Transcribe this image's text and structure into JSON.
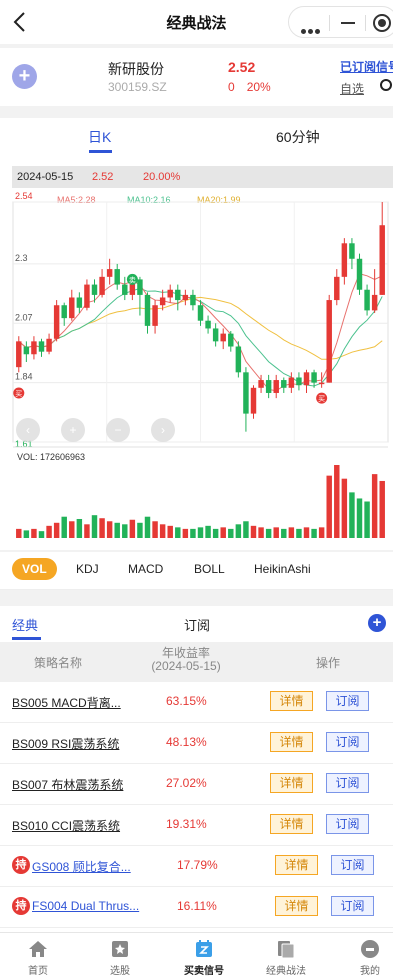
{
  "header": {
    "title": "经典战法"
  },
  "stock": {
    "name": "新研股份",
    "code": "300159.SZ",
    "price": "2.52",
    "change": "0",
    "change_pct": "20%",
    "subscribed_label": "已订阅信号",
    "watchlist_label": "自选"
  },
  "period_tabs": [
    "日K",
    "60分钟"
  ],
  "chart_info": {
    "date": "2024-05-15",
    "price": "2.52",
    "pct": "20.00%"
  },
  "ma": {
    "ma5": "MA5:2.28",
    "ma10": "MA10:2.16",
    "ma20": "MA20:1.99"
  },
  "colors": {
    "up": "#e53935",
    "down": "#21b259",
    "ma5": "#e8716d",
    "ma10": "#4cc28f",
    "ma20": "#f0c040",
    "accent": "#2f54d6"
  },
  "chart_data": {
    "type": "candlestick",
    "y_ticks": [
      "2.54",
      "2.3",
      "2.07",
      "1.84",
      "1.61"
    ],
    "ylim": [
      1.61,
      2.54
    ],
    "candles": [
      [
        1.9,
        2.0,
        2.02,
        1.88
      ],
      [
        1.98,
        1.95,
        2.0,
        1.92
      ],
      [
        1.95,
        2.0,
        2.02,
        1.93
      ],
      [
        2.0,
        1.96,
        2.01,
        1.94
      ],
      [
        1.96,
        2.01,
        2.03,
        1.95
      ],
      [
        2.01,
        2.14,
        2.16,
        2.0
      ],
      [
        2.14,
        2.09,
        2.15,
        2.06
      ],
      [
        2.09,
        2.17,
        2.2,
        2.08
      ],
      [
        2.17,
        2.13,
        2.19,
        2.11
      ],
      [
        2.13,
        2.22,
        2.24,
        2.12
      ],
      [
        2.22,
        2.18,
        2.24,
        2.15
      ],
      [
        2.18,
        2.25,
        2.28,
        2.17
      ],
      [
        2.25,
        2.28,
        2.32,
        2.22
      ],
      [
        2.28,
        2.22,
        2.3,
        2.2
      ],
      [
        2.22,
        2.18,
        2.25,
        2.16
      ],
      [
        2.18,
        2.24,
        2.26,
        2.16
      ],
      [
        2.24,
        2.18,
        2.25,
        2.1
      ],
      [
        2.18,
        2.06,
        2.19,
        2.03
      ],
      [
        2.06,
        2.14,
        2.16,
        2.03
      ],
      [
        2.14,
        2.17,
        2.2,
        2.12
      ],
      [
        2.17,
        2.2,
        2.22,
        2.15
      ],
      [
        2.2,
        2.16,
        2.22,
        2.12
      ],
      [
        2.16,
        2.18,
        2.2,
        2.14
      ],
      [
        2.18,
        2.14,
        2.2,
        2.12
      ],
      [
        2.14,
        2.08,
        2.16,
        2.06
      ],
      [
        2.08,
        2.05,
        2.1,
        2.03
      ],
      [
        2.05,
        2.0,
        2.07,
        1.98
      ],
      [
        2.0,
        2.03,
        2.05,
        1.97
      ],
      [
        2.03,
        1.98,
        2.04,
        1.96
      ],
      [
        1.98,
        1.88,
        2.0,
        1.86
      ],
      [
        1.88,
        1.72,
        1.9,
        1.65
      ],
      [
        1.72,
        1.82,
        1.83,
        1.7
      ],
      [
        1.82,
        1.85,
        1.87,
        1.8
      ],
      [
        1.85,
        1.8,
        1.87,
        1.78
      ],
      [
        1.8,
        1.85,
        1.87,
        1.78
      ],
      [
        1.85,
        1.82,
        1.86,
        1.8
      ],
      [
        1.82,
        1.86,
        1.88,
        1.8
      ],
      [
        1.86,
        1.83,
        1.88,
        1.81
      ],
      [
        1.83,
        1.88,
        1.89,
        1.8
      ],
      [
        1.88,
        1.84,
        1.89,
        1.82
      ],
      [
        1.84,
        1.84,
        1.88,
        1.82
      ],
      [
        1.84,
        2.16,
        2.18,
        1.84
      ],
      [
        2.16,
        2.25,
        2.28,
        2.14
      ],
      [
        2.25,
        2.38,
        2.4,
        2.22
      ],
      [
        2.38,
        2.32,
        2.4,
        2.28
      ],
      [
        2.32,
        2.2,
        2.34,
        2.18
      ],
      [
        2.2,
        2.12,
        2.22,
        2.1
      ],
      [
        2.12,
        2.18,
        2.28,
        2.11
      ],
      [
        2.18,
        2.45,
        2.54,
        2.18
      ]
    ],
    "volume_label": "VOL: 172606963",
    "volumes": [
      12,
      10,
      12,
      9,
      16,
      20,
      28,
      22,
      25,
      18,
      30,
      26,
      22,
      20,
      18,
      24,
      20,
      28,
      22,
      18,
      16,
      14,
      12,
      12,
      14,
      16,
      12,
      14,
      12,
      18,
      22,
      16,
      14,
      12,
      14,
      12,
      14,
      12,
      14,
      12,
      14,
      82,
      96,
      78,
      60,
      52,
      48,
      84,
      75
    ]
  },
  "indicator_tabs": [
    "VOL",
    "KDJ",
    "MACD",
    "BOLL",
    "HeikinAshi"
  ],
  "strategy": {
    "tabs": [
      "经典",
      "订阅"
    ],
    "columns": {
      "name": "策略名称",
      "rate": "年收益率\n(2024-05-15)",
      "op": "操作"
    },
    "detail_label": "详情",
    "subscribe_label": "订阅",
    "hold_badge": "持",
    "rows": [
      {
        "name": "BS005 MACD背离...",
        "rate": "63.15%",
        "held": false
      },
      {
        "name": "BS009 RSI震荡系统",
        "rate": "48.13%",
        "held": false
      },
      {
        "name": "BS007 布林震荡系统",
        "rate": "27.02%",
        "held": false
      },
      {
        "name": "BS010 CCI震荡系统",
        "rate": "19.31%",
        "held": false
      },
      {
        "name": "GS008 顾比复合...",
        "rate": "17.79%",
        "held": true
      },
      {
        "name": "FS004 Dual Thrus...",
        "rate": "16.11%",
        "held": true
      }
    ]
  },
  "nav": [
    "首页",
    "选股",
    "买卖信号",
    "经典战法",
    "我的"
  ]
}
